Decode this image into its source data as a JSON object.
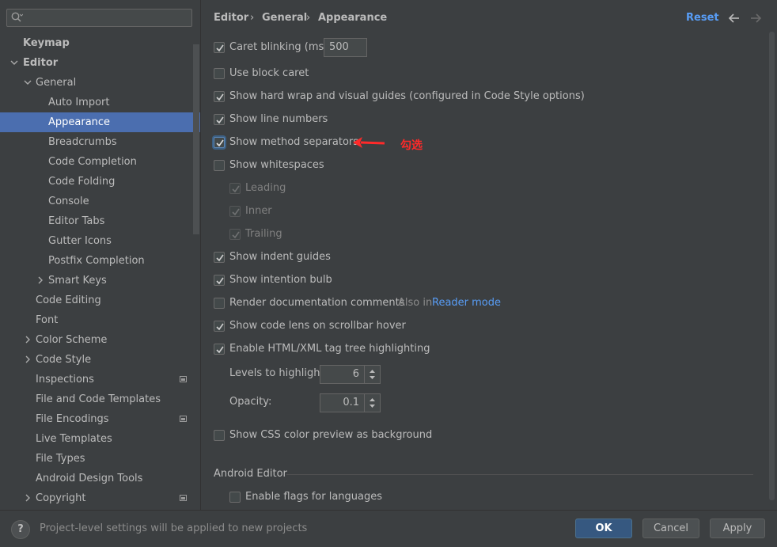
{
  "search": {
    "placeholder": ""
  },
  "sidebar": {
    "items": [
      {
        "label": "Keymap"
      },
      {
        "label": "Editor"
      },
      {
        "label": "General"
      },
      {
        "label": "Auto Import"
      },
      {
        "label": "Appearance"
      },
      {
        "label": "Breadcrumbs"
      },
      {
        "label": "Code Completion"
      },
      {
        "label": "Code Folding"
      },
      {
        "label": "Console"
      },
      {
        "label": "Editor Tabs"
      },
      {
        "label": "Gutter Icons"
      },
      {
        "label": "Postfix Completion"
      },
      {
        "label": "Smart Keys"
      },
      {
        "label": "Code Editing"
      },
      {
        "label": "Font"
      },
      {
        "label": "Color Scheme"
      },
      {
        "label": "Code Style"
      },
      {
        "label": "Inspections"
      },
      {
        "label": "File and Code Templates"
      },
      {
        "label": "File Encodings"
      },
      {
        "label": "Live Templates"
      },
      {
        "label": "File Types"
      },
      {
        "label": "Android Design Tools"
      },
      {
        "label": "Copyright"
      }
    ]
  },
  "header": {
    "breadcrumbs": [
      "Editor",
      "General",
      "Appearance"
    ],
    "separator": "›",
    "reset_label": "Reset"
  },
  "options": {
    "caret_blinking": {
      "label": "Caret blinking (ms):",
      "value": "500",
      "checked": true
    },
    "block_caret": {
      "label": "Use block caret",
      "checked": false
    },
    "hard_wrap": {
      "label": "Show hard wrap and visual guides (configured in Code Style options)",
      "checked": true
    },
    "line_numbers": {
      "label": "Show line numbers",
      "checked": true
    },
    "method_separators": {
      "label": "Show method separators",
      "checked": true
    },
    "whitespaces": {
      "label": "Show whitespaces",
      "checked": false
    },
    "leading": {
      "label": "Leading",
      "checked": true
    },
    "inner": {
      "label": "Inner",
      "checked": true
    },
    "trailing": {
      "label": "Trailing",
      "checked": true
    },
    "indent_guides": {
      "label": "Show indent guides",
      "checked": true
    },
    "intention_bulb": {
      "label": "Show intention bulb",
      "checked": true
    },
    "render_docs": {
      "label": "Render documentation comments",
      "checked": false,
      "also_text": "Also in",
      "link_text": "Reader mode"
    },
    "code_lens": {
      "label": "Show code lens on scrollbar hover",
      "checked": true
    },
    "tag_tree": {
      "label": "Enable HTML/XML tag tree highlighting",
      "checked": true
    },
    "levels": {
      "label": "Levels to highlight:",
      "value": "6"
    },
    "opacity": {
      "label": "Opacity:",
      "value": "0.1"
    },
    "css_color": {
      "label": "Show CSS color preview as background",
      "checked": false
    }
  },
  "android_editor": {
    "title": "Android Editor",
    "flags": {
      "label": "Enable flags for languages",
      "checked": false
    }
  },
  "annotation": {
    "text": "勾选",
    "color": "#ff2a2a"
  },
  "footer": {
    "help_label": "?",
    "message": "Project-level settings will be applied to new projects",
    "ok_label": "OK",
    "cancel_label": "Cancel",
    "apply_label": "Apply"
  },
  "colors": {
    "background": "#3c3f41",
    "selection": "#4b6eaf",
    "link": "#589df6",
    "primary_button": "#365880"
  }
}
